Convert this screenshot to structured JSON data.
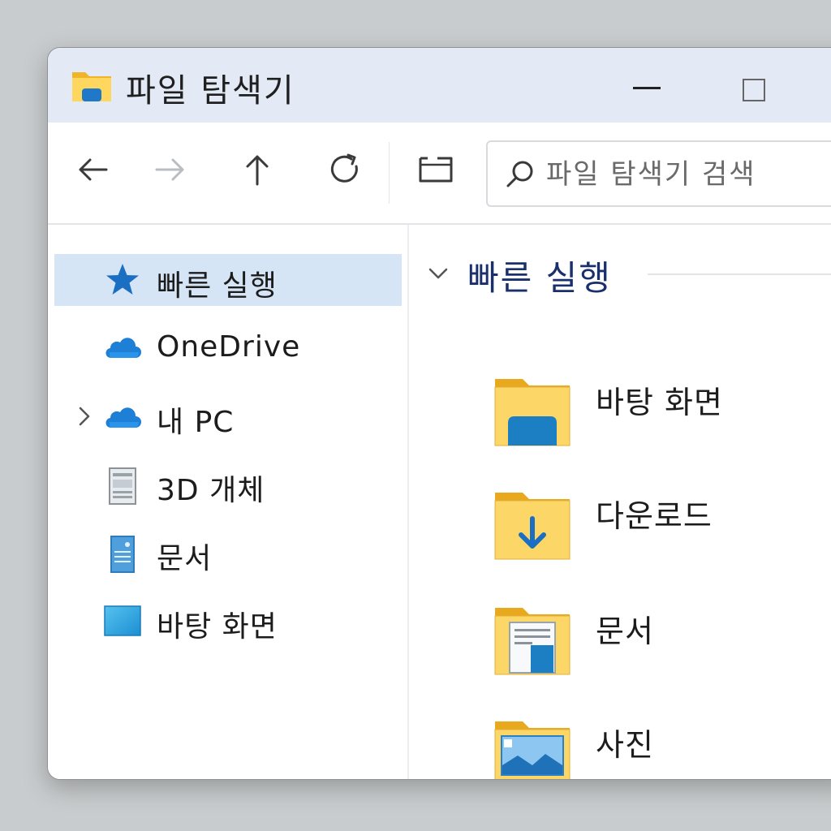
{
  "window": {
    "title": "파일 탐색기"
  },
  "toolbar": {
    "back_icon": "arrow-left-icon",
    "forward_icon": "arrow-right-icon",
    "up_icon": "arrow-up-icon",
    "refresh_icon": "refresh-icon",
    "view_icon": "view-layout-icon"
  },
  "search": {
    "placeholder": "파일 탐색기 검색"
  },
  "sidebar": {
    "items": [
      {
        "label": "빠른 실행",
        "icon": "star-icon",
        "selected": true
      },
      {
        "label": "OneDrive",
        "icon": "cloud-icon"
      },
      {
        "label": "내 PC",
        "icon": "cloud-icon",
        "expandable": true
      },
      {
        "label": "3D 개체",
        "icon": "3d-objects-icon"
      },
      {
        "label": "문서",
        "icon": "document-icon"
      },
      {
        "label": "바탕 화면",
        "icon": "desktop-icon"
      }
    ]
  },
  "content": {
    "group_title": "빠른 실행",
    "items": [
      {
        "label": "바탕 화면",
        "icon": "desktop-folder-icon"
      },
      {
        "label": "다운로드",
        "icon": "downloads-folder-icon"
      },
      {
        "label": "문서",
        "icon": "documents-folder-icon"
      },
      {
        "label": "사진",
        "icon": "pictures-folder-icon"
      }
    ]
  },
  "colors": {
    "accent": "#1a6fc2",
    "titlebar": "#e3eaf5",
    "selection": "#d5e5f5",
    "group_title": "#1a2f6b",
    "folder": "#f5c542"
  }
}
